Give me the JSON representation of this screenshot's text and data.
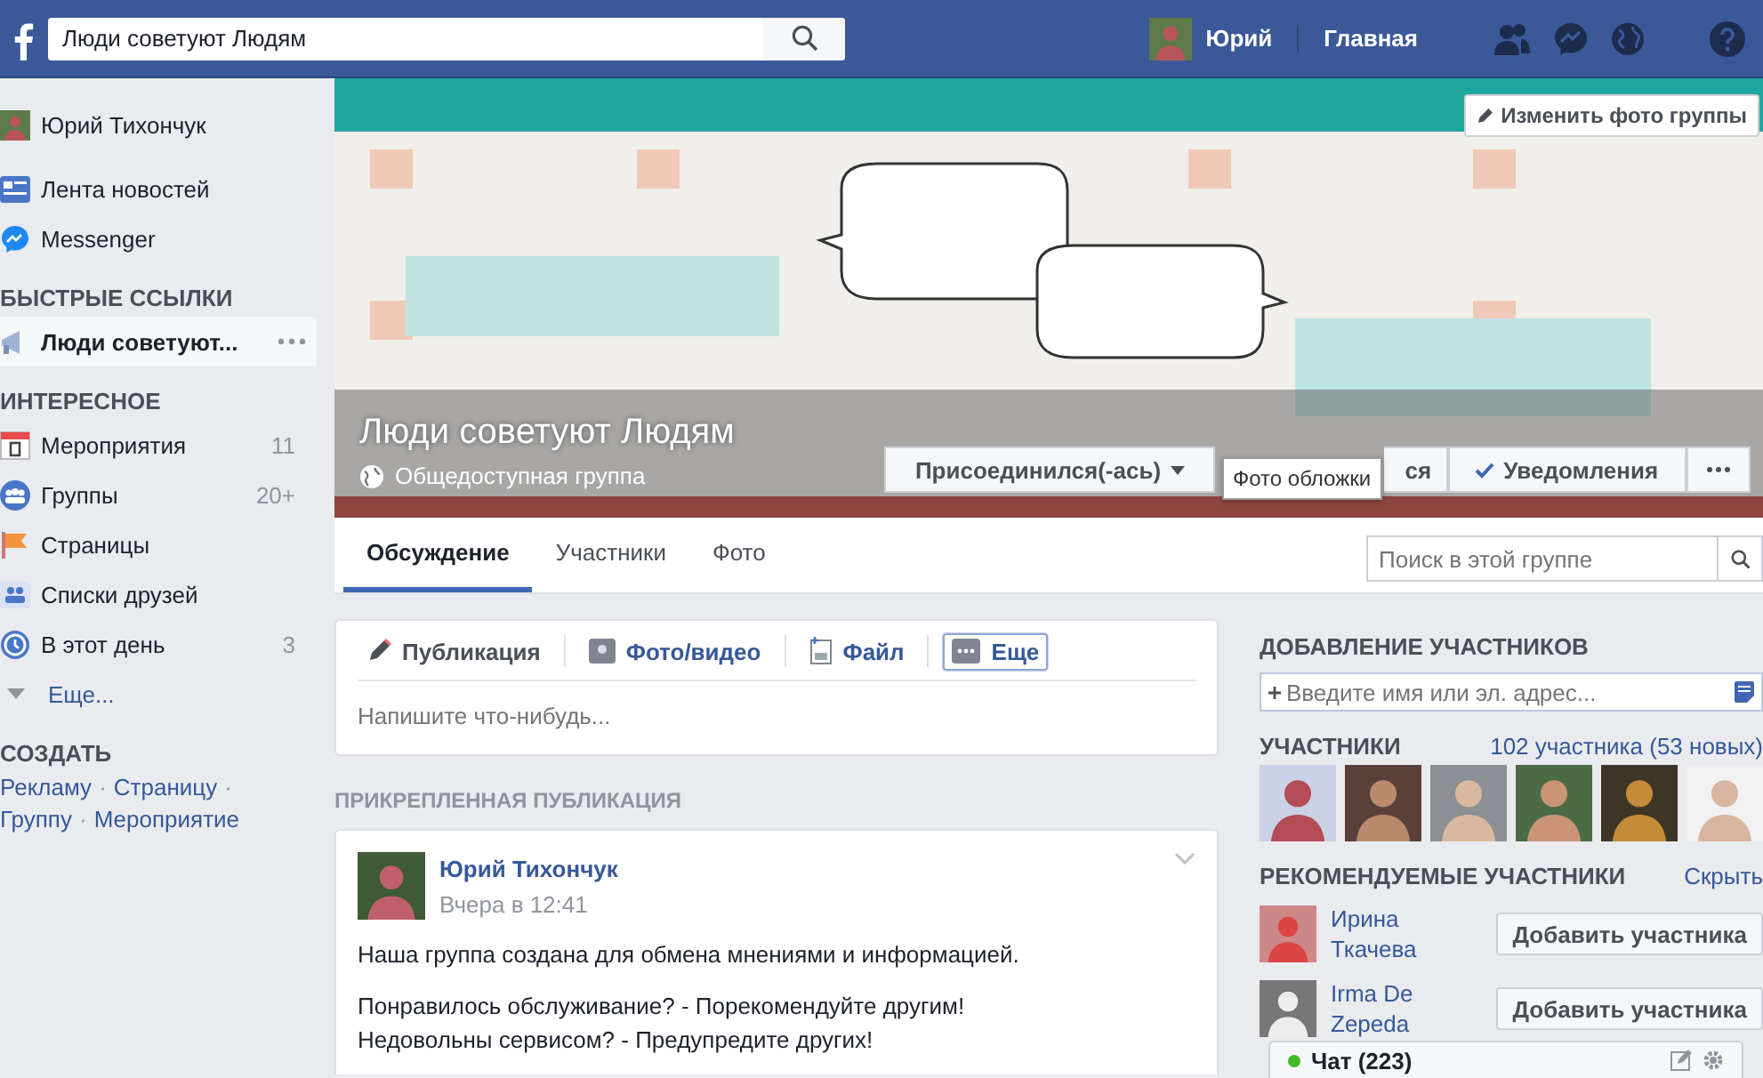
{
  "top_bar": {
    "search": {
      "value": "Люди советуют Людям"
    },
    "user_name": "Юрий",
    "home": "Главная"
  },
  "sidebar": {
    "profile": "Юрий Тихончук",
    "main_items": [
      {
        "label": "Лента новостей",
        "kind": "news"
      },
      {
        "label": "Messenger",
        "kind": "messenger"
      }
    ],
    "sections": [
      {
        "title": "БЫСТРЫЕ ССЫЛКИ",
        "items": [
          {
            "label": "Люди советуют...",
            "kind": "group",
            "selected": true
          }
        ]
      },
      {
        "title": "ИНТЕРЕСНОЕ",
        "items": [
          {
            "label": "Мероприятия",
            "kind": "calendar",
            "count": "11",
            "selected": false
          },
          {
            "label": "Группы",
            "kind": "groups",
            "count": "20+",
            "selected": false
          },
          {
            "label": "Страницы",
            "kind": "flag",
            "selected": false
          },
          {
            "label": "Списки друзей",
            "kind": "friends",
            "selected": false
          },
          {
            "label": "В этот день",
            "kind": "clock",
            "count": "3",
            "selected": false
          },
          {
            "label": "Еще...",
            "kind": "more",
            "selected": false
          }
        ]
      }
    ],
    "create": {
      "title": "СОЗДАТЬ",
      "links": [
        "Рекламу",
        "Страницу",
        "Группу",
        "Мероприятие"
      ],
      "separators": [
        "·",
        "·",
        "·"
      ]
    }
  },
  "cover": {
    "edit_photo": "Изменить фото группы",
    "title": "Люди советуют Людям",
    "privacy": "Общедоступная группа",
    "actions": [
      {
        "label": "Присоединился(-ась)",
        "kind": "dropdown"
      },
      {
        "label": "ся",
        "kind": "plain"
      },
      {
        "label": "Уведомления",
        "kind": "check"
      },
      {
        "kind": "more"
      }
    ],
    "tooltip": "Фото обложки"
  },
  "tabs": [
    {
      "label": "Обсуждение",
      "selected": true
    },
    {
      "label": "Участники",
      "selected": false
    },
    {
      "label": "Фото",
      "selected": false
    }
  ],
  "group_search": {
    "placeholder": "Поиск в этой группе"
  },
  "composer": {
    "actions": [
      {
        "label": "Публикация",
        "kind": "pencil",
        "selected": true,
        "focused": false
      },
      {
        "label": "Фото/видео",
        "kind": "camera",
        "selected": false,
        "focused": false
      },
      {
        "label": "Файл",
        "kind": "file",
        "selected": false,
        "focused": false
      },
      {
        "label": "Еще",
        "kind": "more",
        "selected": false,
        "focused": true
      }
    ],
    "placeholder": "Напишите что-нибудь..."
  },
  "pinned": {
    "heading": "ПРИКРЕПЛЕННАЯ ПУБЛИКАЦИЯ",
    "author": "Юрий Тихончук",
    "time": "Вчера в 12:41",
    "paragraphs": [
      [
        "Наша группа создана для обмена мнениями и информацией."
      ],
      [
        "Понравилось обслуживание? - Порекомендуйте другим!",
        "Недовольны сервисом? - Предупредите других!"
      ]
    ]
  },
  "add_members": {
    "heading": "ДОБАВЛЕНИЕ УЧАСТНИКОВ",
    "placeholder": "Введите имя или эл. адрес..."
  },
  "members": {
    "heading": "УЧАСТНИКИ",
    "count": "102 участника (53 новых)"
  },
  "suggested": {
    "heading": "РЕКОМЕНДУЕМЫЕ УЧАСТНИКИ",
    "hide": "Скрыть",
    "people": [
      {
        "name": "Ирина Ткачева",
        "button": "Добавить участника"
      },
      {
        "name": "Irma De Zepeda",
        "button": "Добавить участника"
      }
    ]
  },
  "chat": {
    "label": "Чат (223)",
    "online": true
  }
}
